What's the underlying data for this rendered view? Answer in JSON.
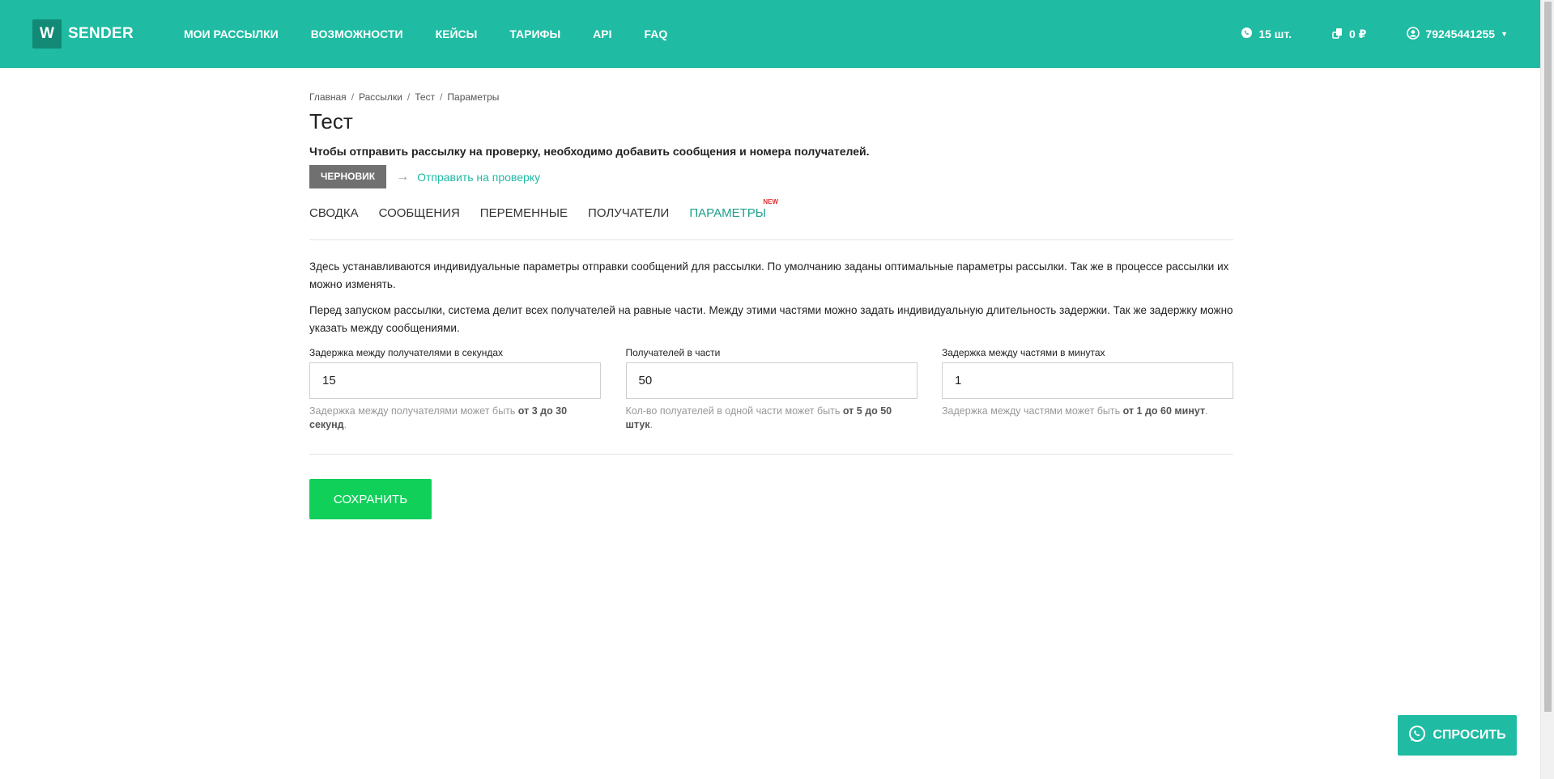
{
  "header": {
    "logo_letter": "W",
    "logo_text": "SENDER",
    "nav": [
      "МОИ РАССЫЛКИ",
      "ВОЗМОЖНОСТИ",
      "КЕЙСЫ",
      "ТАРИФЫ",
      "API",
      "FAQ"
    ],
    "messages_count": "15 шт.",
    "balance": "0 ₽",
    "user_phone": "79245441255",
    "colors": {
      "bar": "#1fbba2",
      "logo_box": "#138a76"
    }
  },
  "breadcrumb": [
    "Главная",
    "Рассылки",
    "Тест",
    "Параметры"
  ],
  "page_title": "Тест",
  "notice": "Чтобы отправить рассылку на проверку, необходимо добавить сообщения и номера получателей.",
  "status": {
    "badge": "ЧЕРНОВИК",
    "arrow": "→",
    "action_link": "Отправить на проверку"
  },
  "tabs": [
    {
      "label": "СВОДКА"
    },
    {
      "label": "СООБЩЕНИЯ"
    },
    {
      "label": "ПЕРЕМЕННЫЕ"
    },
    {
      "label": "ПОЛУЧАТЕЛИ"
    },
    {
      "label": "ПАРАМЕТРЫ",
      "badge": "NEW",
      "active": true
    }
  ],
  "description": [
    "Здесь устанавливаются индивидуальные параметры отправки сообщений для рассылки. По умолчанию заданы оптимальные параметры рассылки. Так же в процессе рассылки их можно изменять.",
    "Перед запуском рассылки, система делит всех получателей на равные части. Между этими частями можно задать индивидуальную длительность задержки. Так же задержку можно указать между сообщениями."
  ],
  "fields": [
    {
      "label": "Задержка между получателями в секундах",
      "value": "15",
      "hint_prefix": "Задержка между получателями может быть ",
      "hint_bold": "от 3 до 30 секунд",
      "hint_suffix": "."
    },
    {
      "label": "Получателей в части",
      "value": "50",
      "hint_prefix": "Кол-во полуателей в одной части может быть ",
      "hint_bold": "от 5 до 50 штук",
      "hint_suffix": "."
    },
    {
      "label": "Задержка между частями в минутах",
      "value": "1",
      "hint_prefix": "Задержка между частями может быть ",
      "hint_bold": "от 1 до 60 минут",
      "hint_suffix": "."
    }
  ],
  "save_label": "СОХРАНИТЬ",
  "ask_label": "СПРОСИТЬ",
  "colors": {
    "accent": "#1fbba2",
    "save": "#11d05a",
    "status_badge": "#707070",
    "new_badge": "#e03030"
  }
}
